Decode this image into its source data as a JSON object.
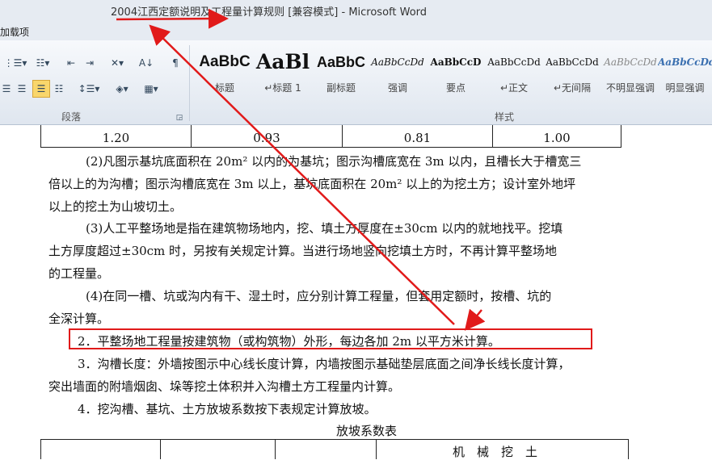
{
  "window": {
    "title": "2004江西定额说明及工程量计算规则 [兼容模式] - Microsoft Word",
    "tab_fragment": "加载项"
  },
  "ribbon": {
    "paragraph_group_label": "段落",
    "styles_group_label": "样式",
    "styles": [
      {
        "sample": "AaBbC",
        "name": "标题"
      },
      {
        "sample": "AaBl",
        "name": "↵标题 1"
      },
      {
        "sample": "AaBbC",
        "name": "副标题"
      },
      {
        "sample": "AaBbCcDd",
        "name": "强调"
      },
      {
        "sample": "AaBbCcD",
        "name": "要点"
      },
      {
        "sample": "AaBbCcDd",
        "name": "↵正文"
      },
      {
        "sample": "AaBbCcDd",
        "name": "↵无间隔"
      },
      {
        "sample": "AaBbCcDd",
        "name": "不明显强调"
      },
      {
        "sample": "AaBbCcDd",
        "name": "明显强调"
      }
    ],
    "icons": [
      "bullets-icon",
      "multilevel-list-icon",
      "decrease-indent-icon",
      "increase-indent-icon",
      "chinese-layout-icon",
      "sort-icon",
      "show-marks-icon",
      "align-center-icon",
      "align-right-icon",
      "justify-icon",
      "distributed-icon",
      "line-spacing-icon",
      "shading-icon",
      "borders-icon"
    ],
    "colors": {
      "ribbon_bg": "#dfe6ef",
      "active_button": "#f9d66b",
      "annotation_red": "#e11a1a"
    }
  },
  "document": {
    "top_table_row": [
      "1.20",
      "0.93",
      "0.81",
      "1.00"
    ],
    "lines": [
      "(2)凡图示基坑底面积在 20m² 以内的为基坑；图示沟槽底宽在 3m 以内，且槽长大于槽宽三",
      "倍以上的为沟槽；图示沟槽底宽在 3m 以上，基坑底面积在 20m² 以上的为挖土方；设计室外地坪",
      "以上的挖土为山坡切土。",
      "(3)人工平整场地是指在建筑物场地内，挖、填土方厚度在±30cm 以内的就地找平。挖填",
      "土方厚度超过±30cm 时，另按有关规定计算。当进行场地竖向挖填土方时，不再计算平整场地",
      "的工程量。",
      "(4)在同一槽、坑或沟内有干、湿土时，应分别计算工程量，但套用定额时，按槽、坑的",
      "全深计算。",
      "2．平整场地工程量按建筑物（或构筑物）外形，每边各加 2m 以平方米计算。",
      "3．沟槽长度：外墙按图示中心线长度计算，内墙按图示基础垫层底面之间净长线长度计算，",
      "突出墙面的附墙烟囱、垛等挖土体积并入沟槽土方工程量内计算。",
      "4．挖沟槽、基坑、土方放坡系数按下表规定计算放坡。"
    ],
    "table_caption": "放坡系数表",
    "bottom_table_header": "机　械　挖　土"
  }
}
